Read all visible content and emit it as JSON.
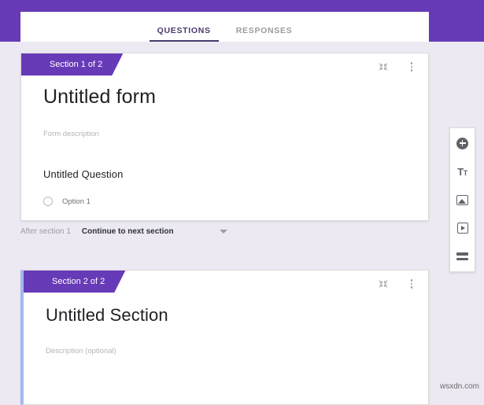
{
  "app": {
    "accent_purple": "#673ab7",
    "page_background": "#ece9f3",
    "selected_border": "#a3b9f0"
  },
  "header": {
    "tabs": [
      {
        "label": "QUESTIONS",
        "active": true
      },
      {
        "label": "RESPONSES",
        "active": false
      }
    ]
  },
  "section1": {
    "ribbon_label": "Section 1 of 2",
    "collapse_icon": "collapse-icon",
    "more_icon": "more-vert-icon",
    "form_title": "Untitled form",
    "form_description_placeholder": "Form description",
    "question": {
      "title": "Untitled Question",
      "options": [
        {
          "label": "Option 1"
        }
      ]
    }
  },
  "after_section": {
    "label": "After section 1",
    "value": "Continue to next section",
    "caret_icon": "chevron-down-icon"
  },
  "section2": {
    "ribbon_label": "Section 2 of 2",
    "collapse_icon": "collapse-icon",
    "more_icon": "more-vert-icon",
    "section_title": "Untitled Section",
    "section_description_placeholder": "Description (optional)"
  },
  "toolbar": {
    "items": [
      {
        "icon": "add-question-icon",
        "name": "add-question"
      },
      {
        "icon": "add-title-icon",
        "name": "add-title-and-description",
        "glyph": "Tt"
      },
      {
        "icon": "add-image-icon",
        "name": "add-image"
      },
      {
        "icon": "add-video-icon",
        "name": "add-video"
      },
      {
        "icon": "add-section-icon",
        "name": "add-section"
      }
    ]
  },
  "watermark": {
    "text": "wsxdn.com"
  }
}
